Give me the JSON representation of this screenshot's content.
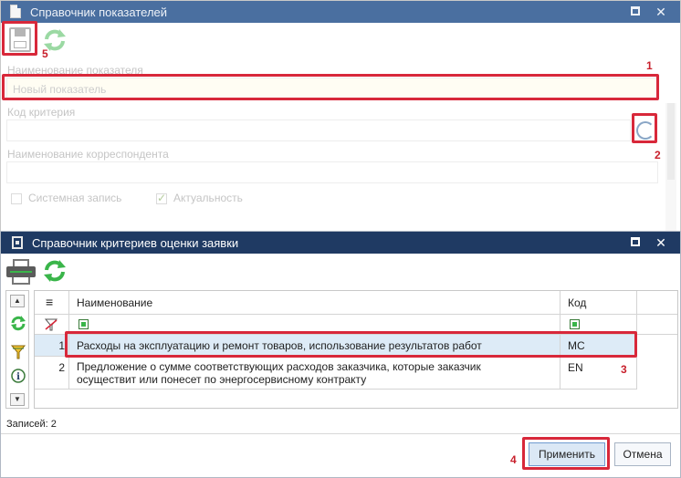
{
  "main_window": {
    "title": "Справочник показателей",
    "fields": {
      "indicator_name": {
        "label": "Наименование показателя",
        "value": "Новый показатель"
      },
      "criterion_code": {
        "label": "Код критерия",
        "value": ""
      },
      "correspondent_name": {
        "label": "Наименование корреспондента",
        "value": ""
      }
    },
    "checkboxes": {
      "system_record": {
        "label": "Системная запись",
        "checked": false
      },
      "relevance": {
        "label": "Актуальность",
        "checked": true
      }
    }
  },
  "dialog": {
    "title": "Справочник критериев оценки заявки",
    "columns": {
      "menu": "≡",
      "name": "Наименование",
      "code": "Код"
    },
    "rows": [
      {
        "num": "1",
        "name": "Расходы на эксплуатацию и ремонт товаров, использование результатов работ",
        "code": "МС"
      },
      {
        "num": "2",
        "name": "Предложение о сумме соответствующих расходов заказчика, которые заказчик осуществит или понесет по энергосервисному контракту",
        "code": "EN"
      }
    ],
    "records_label": "Записей: 2",
    "apply_label": "Применить",
    "cancel_label": "Отмена"
  },
  "annotations": {
    "n1": "1",
    "n2": "2",
    "n3": "3",
    "n4": "4",
    "n5": "5"
  },
  "colors": {
    "highlight": "#d8283a",
    "title_bar": "#1f3a63",
    "selected_row": "#ddebf7"
  }
}
